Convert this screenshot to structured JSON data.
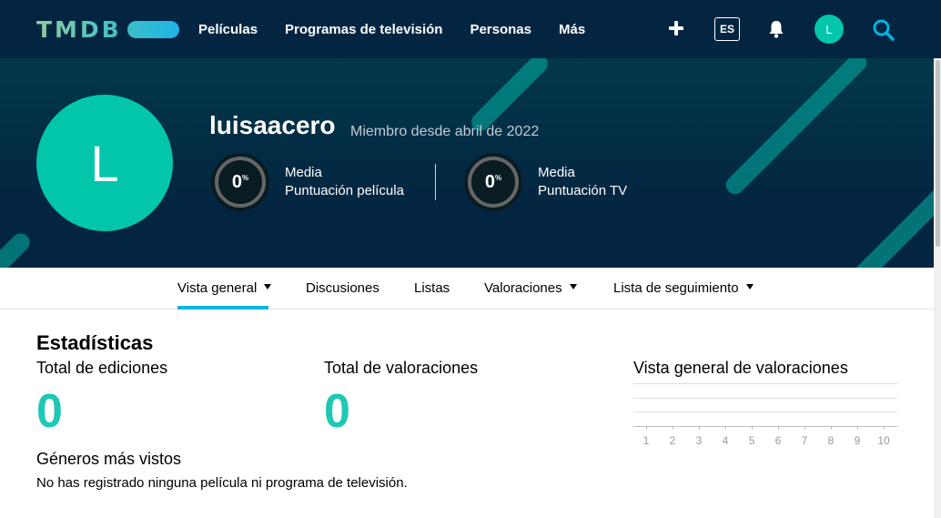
{
  "topnav": {
    "logo_text": "TMDB",
    "links": [
      "Películas",
      "Programas de televisión",
      "Personas",
      "Más"
    ],
    "lang": "ES",
    "user_initial": "L"
  },
  "profile": {
    "initial": "L",
    "username": "luisaacero",
    "member_since": "Miembro desde abril de 2022",
    "movie_score": {
      "value": "0",
      "unit": "%",
      "label_line1": "Media",
      "label_line2": "Puntuación película"
    },
    "tv_score": {
      "value": "0",
      "unit": "%",
      "label_line1": "Media",
      "label_line2": "Puntuación TV"
    }
  },
  "subnav": {
    "items": [
      "Vista general",
      "Discusiones",
      "Listas",
      "Valoraciones",
      "Lista de seguimiento"
    ]
  },
  "stats": {
    "title": "Estadísticas",
    "total_edits_label": "Total de ediciones",
    "total_edits_value": "0",
    "total_ratings_label": "Total de valoraciones",
    "total_ratings_value": "0",
    "genres_title": "Géneros más vistos",
    "genres_empty": "No has registrado ninguna película ni programa de televisión."
  },
  "ratings_overview": {
    "title": "Vista general de valoraciones",
    "axis": [
      "1",
      "2",
      "3",
      "4",
      "5",
      "6",
      "7",
      "8",
      "9",
      "10"
    ]
  },
  "colors": {
    "nav_bg": "#032541",
    "accent_teal": "#01c6ac",
    "stat_value": "#1fc8b3",
    "tab_underline": "#01b4e4"
  }
}
